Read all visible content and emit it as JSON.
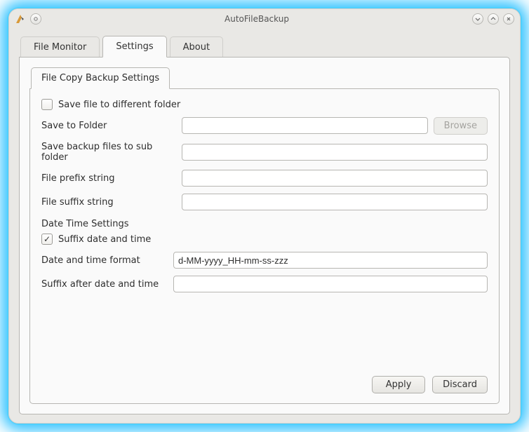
{
  "window_title": "AutoFileBackup",
  "app_icon_name": "app-icon",
  "tabs": {
    "file_monitor": "File Monitor",
    "settings": "Settings",
    "about": "About"
  },
  "inner_tab": "File Copy Backup Settings",
  "form": {
    "save_diff_folder": {
      "label": "Save file to different folder",
      "checked": false
    },
    "save_to_folder": {
      "label": "Save to Folder",
      "value": "",
      "browse": "Browse"
    },
    "save_backup_sub": {
      "label": "Save backup files to sub folder",
      "value": ""
    },
    "prefix": {
      "label": "File prefix string",
      "value": ""
    },
    "suffix": {
      "label": "File suffix string",
      "value": ""
    },
    "dt_heading": "Date Time Settings",
    "suffix_dt": {
      "label": "Suffix date and time",
      "checked": true
    },
    "dt_format": {
      "label": "Date and time format",
      "value": "d-MM-yyyy_HH-mm-ss-zzz"
    },
    "suffix_after": {
      "label": "Suffix after date and time",
      "value": ""
    }
  },
  "buttons": {
    "apply": "Apply",
    "discard": "Discard"
  }
}
